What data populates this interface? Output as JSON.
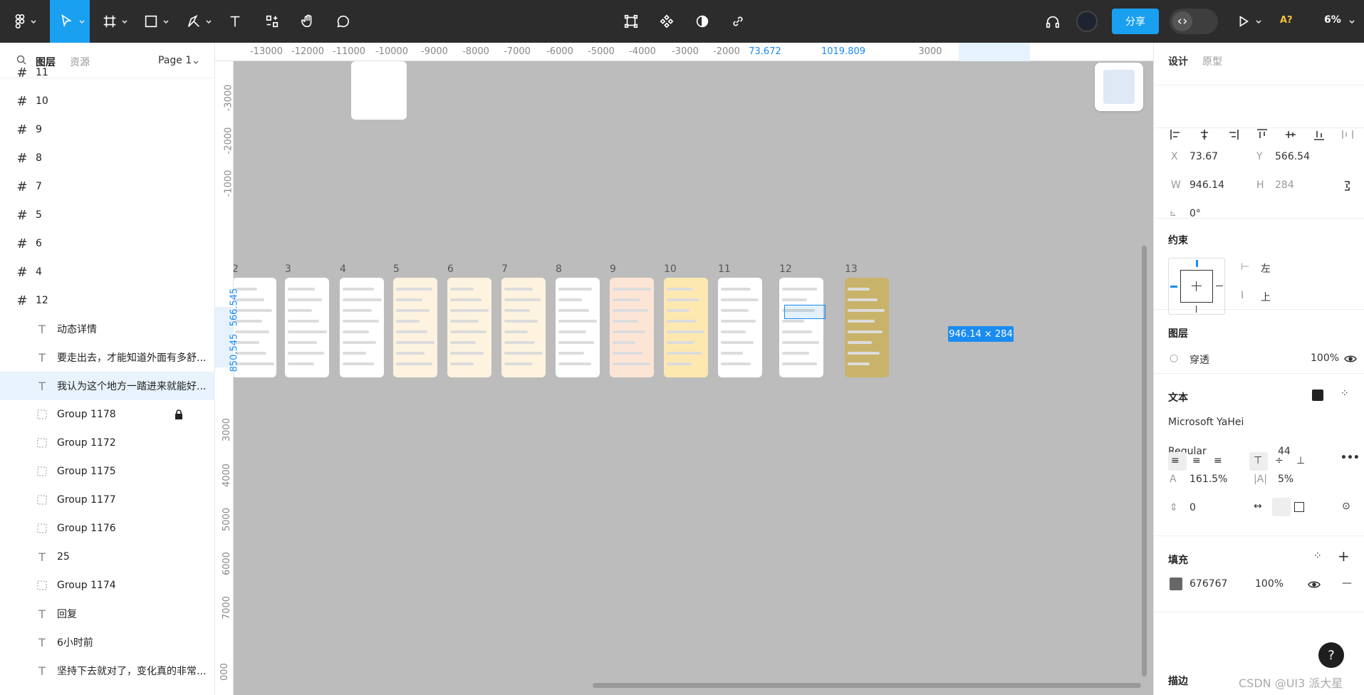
{
  "toolbar": {
    "share_label": "分享",
    "zoom_label": "6%",
    "ai_label": "A?"
  },
  "left_panel": {
    "tabs": [
      "图层",
      "资源"
    ],
    "page_selector": "Page 1",
    "layers": [
      {
        "type": "frame",
        "label": "11"
      },
      {
        "type": "frame",
        "label": "10"
      },
      {
        "type": "frame",
        "label": "9"
      },
      {
        "type": "frame",
        "label": "8"
      },
      {
        "type": "frame",
        "label": "7"
      },
      {
        "type": "frame",
        "label": "5"
      },
      {
        "type": "frame",
        "label": "6"
      },
      {
        "type": "frame",
        "label": "4"
      },
      {
        "type": "frame",
        "label": "12"
      },
      {
        "type": "text",
        "label": "动态详情"
      },
      {
        "type": "text",
        "label": "要走出去，才能知道外面有多舒..."
      },
      {
        "type": "text",
        "label": "我认为这个地方一踏进来就能好...",
        "selected": true
      },
      {
        "type": "group",
        "label": "Group 1178",
        "locked": true
      },
      {
        "type": "group",
        "label": "Group 1172"
      },
      {
        "type": "group",
        "label": "Group 1175"
      },
      {
        "type": "group",
        "label": "Group 1177"
      },
      {
        "type": "group",
        "label": "Group 1176"
      },
      {
        "type": "text",
        "label": "25"
      },
      {
        "type": "group",
        "label": "Group 1174"
      },
      {
        "type": "text",
        "label": "回复"
      },
      {
        "type": "text",
        "label": "6小时前"
      },
      {
        "type": "text",
        "label": "坚持下去就对了，变化真的非常..."
      }
    ]
  },
  "ruler": {
    "top": [
      "-13000",
      "-12000",
      "-11000",
      "-10000",
      "-9000",
      "-8000",
      "-7000",
      "-6000",
      "-5000",
      "-4000",
      "-3000",
      "-2000",
      "73.672",
      "1019.809",
      "3000"
    ],
    "left": [
      "-3000",
      "-2000",
      "-1000",
      "566.545",
      "850.545",
      "3000",
      "4000",
      "5000",
      "6000",
      "7000",
      "000"
    ]
  },
  "canvas": {
    "frame_labels": [
      "2",
      "3",
      "4",
      "5",
      "6",
      "7",
      "8",
      "9",
      "10",
      "11",
      "12",
      "13"
    ],
    "dimension_badge": "946.14 × 284"
  },
  "right_panel": {
    "tabs": [
      "设计",
      "原型"
    ],
    "x_label": "X",
    "x_value": "73.67",
    "y_label": "Y",
    "y_value": "566.54",
    "w_label": "W",
    "w_value": "946.14",
    "h_label": "H",
    "h_value": "284",
    "rotation": "0°",
    "constraints_title": "约束",
    "constraint_h": "左",
    "constraint_v": "上",
    "layer_title": "图层",
    "blend_mode": "穿透",
    "layer_opacity": "100%",
    "text_title": "文本",
    "font_family": "Microsoft YaHei",
    "font_weight": "Regular",
    "font_size": "44",
    "line_height": "161.5%",
    "letter_spacing": "5%",
    "paragraph_spacing": "0",
    "fill_title": "填充",
    "fill_color": "676767",
    "fill_opacity": "100%",
    "stroke_title": "描边"
  },
  "watermark": "CSDN @UI3 派大星",
  "colors": {
    "accent": "#1aa0f0",
    "fill_swatch": "#676767",
    "selection": "#1a8cf0"
  }
}
